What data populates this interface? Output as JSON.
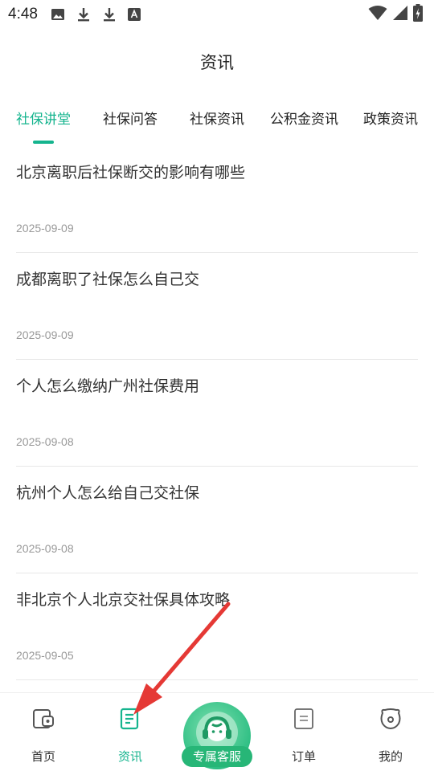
{
  "status_bar": {
    "time": "4:48",
    "left_icons": [
      "image-icon",
      "download-icon",
      "download-icon",
      "font-icon"
    ],
    "right_icons": [
      "wifi-icon",
      "cellular-icon",
      "battery-icon"
    ]
  },
  "header": {
    "title": "资讯"
  },
  "tabs": [
    {
      "label": "社保讲堂",
      "active": true
    },
    {
      "label": "社保问答"
    },
    {
      "label": "社保资讯"
    },
    {
      "label": "公积金资讯"
    },
    {
      "label": "政策资讯"
    }
  ],
  "articles": [
    {
      "title": "北京离职后社保断交的影响有哪些",
      "date": "2025-09-09"
    },
    {
      "title": "成都离职了社保怎么自己交",
      "date": "2025-09-09"
    },
    {
      "title": "个人怎么缴纳广州社保费用",
      "date": "2025-09-08"
    },
    {
      "title": "杭州个人怎么给自己交社保",
      "date": "2025-09-08"
    },
    {
      "title": "非北京个人北京交社保具体攻略",
      "date": "2025-09-05"
    }
  ],
  "bottom_nav": {
    "home": {
      "label": "首页",
      "icon": "home-icon"
    },
    "news": {
      "label": "资讯",
      "icon": "news-icon",
      "active": true
    },
    "service": {
      "label": "专属客服",
      "icon": "customer-service-icon"
    },
    "orders": {
      "label": "订单",
      "icon": "orders-icon"
    },
    "mine": {
      "label": "我的",
      "icon": "profile-icon"
    }
  },
  "colors": {
    "accent": "#15b48e",
    "annotation_arrow": "#e53935"
  }
}
